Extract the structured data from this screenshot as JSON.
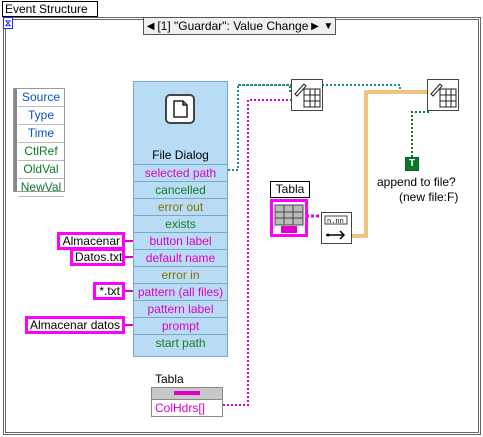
{
  "structure": {
    "title": "Event Structure",
    "case_label": "[1] \"Guardar\": Value Change",
    "corner_icon_symbol": "⧖"
  },
  "event_data_node": {
    "items": [
      "Source",
      "Type",
      "Time",
      "CtlRef",
      "OldVal",
      "NewVal"
    ]
  },
  "file_dialog": {
    "title": "File Dialog",
    "terminals": [
      {
        "label": "selected path",
        "kind": "pink"
      },
      {
        "label": "cancelled",
        "kind": "grn"
      },
      {
        "label": "error out",
        "kind": "gold"
      },
      {
        "label": "exists",
        "kind": "grn"
      },
      {
        "label": "button label",
        "kind": "pink"
      },
      {
        "label": "default name",
        "kind": "pink"
      },
      {
        "label": "error in",
        "kind": "gold"
      },
      {
        "label": "pattern (all files)",
        "kind": "pink"
      },
      {
        "label": "pattern label",
        "kind": "pink"
      },
      {
        "label": "prompt",
        "kind": "pink"
      },
      {
        "label": "start path",
        "kind": "grn"
      }
    ]
  },
  "constants": {
    "almacenar": "Almacenar",
    "datos": "Datos.txt",
    "pattern": "*.txt",
    "prompt": "Almacenar datos"
  },
  "tabla_terminal": {
    "label": "Tabla"
  },
  "property_node": {
    "label": "Tabla",
    "property": "ColHdrs[]"
  },
  "append": {
    "bool_symbol": "T",
    "line1": "append to file?",
    "line2": "(new file:F)"
  },
  "colors": {
    "string_wire": "#e000c8",
    "path_wire": "#1a8a8a",
    "bool_wire": "#0a7a2a",
    "error_wire": "#e08a00"
  }
}
